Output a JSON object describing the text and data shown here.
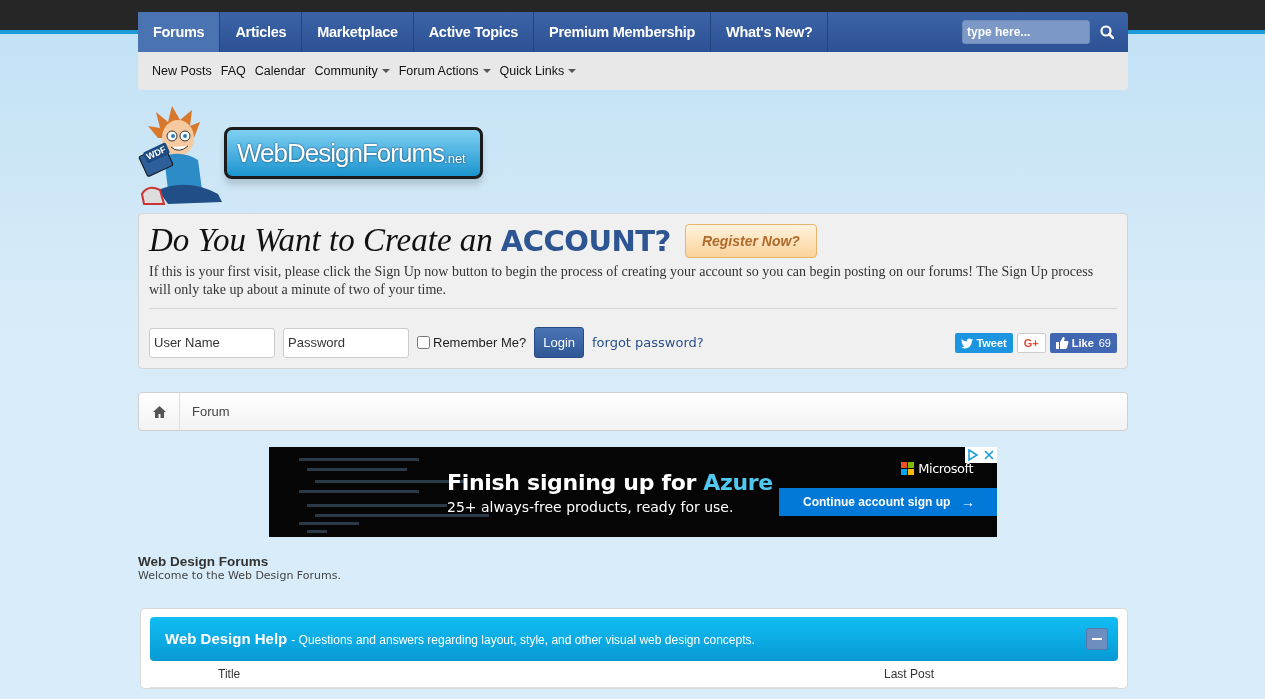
{
  "nav": {
    "tabs": [
      {
        "label": "Forums",
        "selected": true
      },
      {
        "label": "Articles",
        "selected": false
      },
      {
        "label": "Marketplace",
        "selected": false
      },
      {
        "label": "Active Topics",
        "selected": false
      },
      {
        "label": "Premium Membership",
        "selected": false
      },
      {
        "label": "What's New?",
        "selected": false
      }
    ],
    "search": {
      "placeholder": "type here..."
    }
  },
  "subnav": [
    {
      "label": "New Posts",
      "dropdown": false
    },
    {
      "label": "FAQ",
      "dropdown": false
    },
    {
      "label": "Calendar",
      "dropdown": false
    },
    {
      "label": "Community",
      "dropdown": true
    },
    {
      "label": "Forum Actions",
      "dropdown": true
    },
    {
      "label": "Quick Links",
      "dropdown": true
    }
  ],
  "logo": {
    "title": "WebDesignForums",
    "suffix": ".net",
    "badge": "WDF"
  },
  "signup": {
    "heading": "Do You Want to Create an",
    "heading_emphasis": "ACCOUNT?",
    "register_button": "Register Now?",
    "text": "If this is your first visit, please click the Sign Up now button to begin the process of creating your account so you can begin posting on our forums! The Sign Up process will only take up about a minute of two of your time.",
    "username_placeholder": "User Name",
    "password_placeholder": "Password",
    "remember_label": "Remember Me?",
    "remember_checked": false,
    "login_button": "Login",
    "forgot_link": "forgot password?",
    "social": {
      "tweet": "Tweet",
      "gplus": "G+",
      "like": "Like",
      "like_count": "69"
    }
  },
  "breadcrumb": [
    {
      "label": "Forum"
    }
  ],
  "ad": {
    "headline": "Finish signing up for",
    "headline_emphasis": "Azure",
    "subline": "25+ always-free products, ready for use.",
    "brand": "Microsoft",
    "button": "Continue account sign up",
    "button_arrow": "→"
  },
  "forum_section": {
    "title": "Web Design Forums",
    "subtitle": "Welcome to the Web Design Forums."
  },
  "category": {
    "title": "Web Design Help",
    "description": "- Questions and answers regarding layout, style, and other visual web design concepts.",
    "collapsed": false,
    "columns": [
      "Title",
      "Last Post"
    ]
  }
}
